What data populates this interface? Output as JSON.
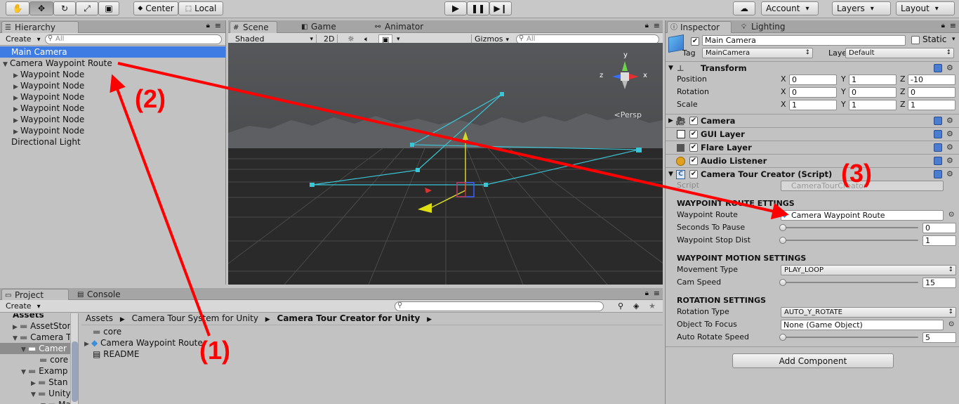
{
  "toolbar": {
    "hand_icon": "hand-icon",
    "move_icon": "move-icon",
    "rotate_icon": "rotate-icon",
    "scale_icon": "scale-icon",
    "rect_icon": "rect-icon",
    "pivot_label": "Center",
    "space_label": "Local",
    "account_label": "Account",
    "layers_label": "Layers",
    "layout_label": "Layout"
  },
  "hierarchy": {
    "tab": "Hierarchy",
    "create": "Create",
    "search_placeholder": "All",
    "items": [
      {
        "label": "Main Camera"
      },
      {
        "label": "Camera Waypoint Route"
      },
      {
        "label": "Waypoint Node"
      },
      {
        "label": "Waypoint Node"
      },
      {
        "label": "Waypoint Node"
      },
      {
        "label": "Waypoint Node"
      },
      {
        "label": "Waypoint Node"
      },
      {
        "label": "Waypoint Node"
      },
      {
        "label": "Directional Light"
      }
    ]
  },
  "scene": {
    "tabs": [
      "Scene",
      "Game",
      "Animator"
    ],
    "shading": "Shaded",
    "mode_2d": "2D",
    "gizmos": "Gizmos",
    "search_placeholder": "All",
    "persp": "Persp",
    "axis_y": "y",
    "axis_x": "x",
    "axis_z": "z"
  },
  "project": {
    "tabs": [
      "Project",
      "Console"
    ],
    "create": "Create",
    "tree": [
      "Assets",
      "AssetStor",
      "Camera T",
      "Camer",
      "core",
      "Examp",
      "Stan",
      "Unity",
      "Ma"
    ],
    "breadcrumb": [
      "Assets",
      "Camera Tour System for Unity",
      "Camera Tour Creator for Unity"
    ],
    "files": [
      "core",
      "Camera Waypoint Route",
      "README"
    ]
  },
  "inspector": {
    "tabs": [
      "Inspector",
      "Lighting"
    ],
    "object_name": "Main Camera",
    "static_label": "Static",
    "tag_label": "Tag",
    "tag_value": "MainCamera",
    "layer_label": "Layer",
    "layer_value": "Default",
    "transform": {
      "title": "Transform",
      "rows": [
        {
          "label": "Position",
          "x": "0",
          "y": "1",
          "z": "-10"
        },
        {
          "label": "Rotation",
          "x": "0",
          "y": "0",
          "z": "0"
        },
        {
          "label": "Scale",
          "x": "1",
          "y": "1",
          "z": "1"
        }
      ],
      "x_label": "X",
      "y_label": "Y",
      "z_label": "Z"
    },
    "components": [
      "Camera",
      "GUI Layer",
      "Flare Layer",
      "Audio Listener",
      "Camera Tour Creator (Script)"
    ],
    "script_label": "Script",
    "script_value": "CameraTourCreator",
    "sections": [
      {
        "title": "WAYPOINT ROUTE ETTINGS",
        "rows": [
          {
            "label": "Waypoint Route",
            "value": "Camera Waypoint Route"
          },
          {
            "label": "Seconds To Pause",
            "value": "0",
            "slider": 0.0
          },
          {
            "label": "Waypoint Stop Dist",
            "value": "1",
            "slider": 0.0
          }
        ]
      },
      {
        "title": "WAYPOINT MOTION SETTINGS",
        "rows": [
          {
            "label": "Movement Type",
            "value": "PLAY_LOOP"
          },
          {
            "label": "Cam Speed",
            "value": "15",
            "slider": 0.0
          }
        ]
      },
      {
        "title": "ROTATION SETTINGS",
        "rows": [
          {
            "label": "Rotation Type",
            "value": "AUTO_Y_ROTATE"
          },
          {
            "label": "Object To Focus",
            "value": "None (Game Object)"
          },
          {
            "label": "Auto Rotate Speed",
            "value": "5",
            "slider": 0.0
          }
        ]
      }
    ],
    "add_component": "Add Component"
  },
  "annotations": [
    "(1)",
    "(2)",
    "(3)"
  ],
  "colors": {
    "annotation": "#ff0000",
    "selection": "#3e7ce4",
    "gizmo_route": "#39c6d6"
  }
}
